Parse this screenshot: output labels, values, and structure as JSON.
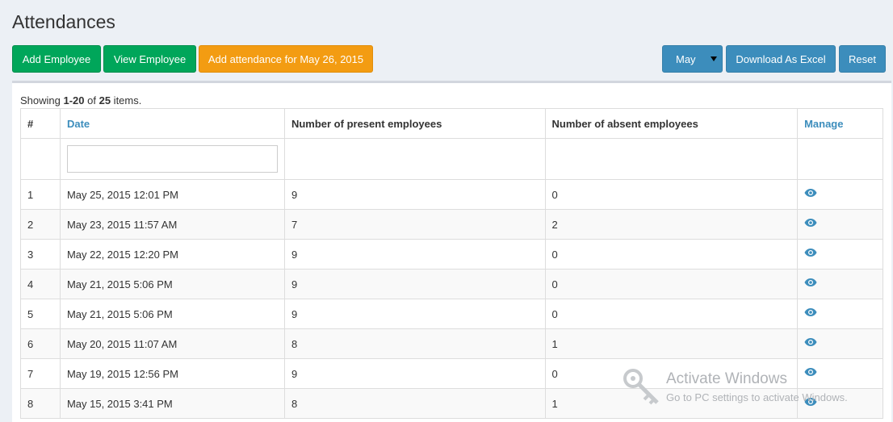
{
  "page": {
    "title": "Attendances"
  },
  "toolbar": {
    "add_employee": "Add Employee",
    "view_employee": "View Employee",
    "add_attendance": "Add attendance for May 26, 2015",
    "month_select": "May",
    "download_excel": "Download As Excel",
    "reset": "Reset"
  },
  "summary": {
    "prefix": "Showing ",
    "range": "1-20",
    "of": " of ",
    "total": "25",
    "suffix": " items."
  },
  "table": {
    "headers": [
      "#",
      "Date",
      "Number of present employees",
      "Number of absent employees",
      "Manage"
    ],
    "rows": [
      {
        "num": "1",
        "date": "May 25, 2015 12:01 PM",
        "present": "9",
        "absent": "0"
      },
      {
        "num": "2",
        "date": "May 23, 2015 11:57 AM",
        "present": "7",
        "absent": "2"
      },
      {
        "num": "3",
        "date": "May 22, 2015 12:20 PM",
        "present": "9",
        "absent": "0"
      },
      {
        "num": "4",
        "date": "May 21, 2015 5:06 PM",
        "present": "9",
        "absent": "0"
      },
      {
        "num": "5",
        "date": "May 21, 2015 5:06 PM",
        "present": "9",
        "absent": "0"
      },
      {
        "num": "6",
        "date": "May 20, 2015 11:07 AM",
        "present": "8",
        "absent": "1"
      },
      {
        "num": "7",
        "date": "May 19, 2015 12:56 PM",
        "present": "9",
        "absent": "0"
      },
      {
        "num": "8",
        "date": "May 15, 2015 3:41 PM",
        "present": "8",
        "absent": "1"
      }
    ],
    "manage_icon": "eye-icon"
  },
  "watermark": {
    "title": "Activate Windows",
    "subtitle": "Go to PC settings to activate Windows."
  },
  "colors": {
    "green": "#00a65a",
    "orange": "#f39c12",
    "blue": "#3c8dbc",
    "link": "#3c8dbc"
  }
}
